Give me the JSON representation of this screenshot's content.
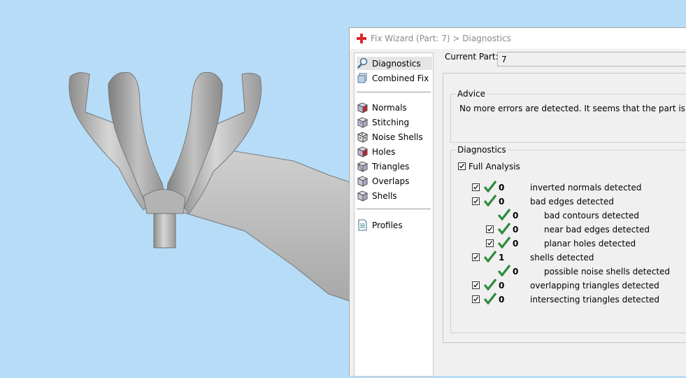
{
  "dialog": {
    "title": "Fix Wizard (Part: 7) > Diagnostics"
  },
  "nav": {
    "items": [
      {
        "label": "Diagnostics",
        "icon": "magnifier-icon"
      },
      {
        "label": "Combined Fix",
        "icon": "combined-fix-icon"
      },
      {
        "label": "Normals",
        "icon": "normals-cube-icon"
      },
      {
        "label": "Stitching",
        "icon": "stitching-cube-icon"
      },
      {
        "label": "Noise Shells",
        "icon": "noise-shells-dice-icon"
      },
      {
        "label": "Holes",
        "icon": "holes-cube-icon"
      },
      {
        "label": "Triangles",
        "icon": "triangles-cube-icon"
      },
      {
        "label": "Overlaps",
        "icon": "overlaps-cube-icon"
      },
      {
        "label": "Shells",
        "icon": "shells-cube-icon"
      },
      {
        "label": "Profiles",
        "icon": "profiles-document-icon"
      }
    ]
  },
  "current_part": {
    "label": "Current Part:",
    "value": "7"
  },
  "advice": {
    "title": "Advice",
    "text": "No more errors are detected. It seems that the part is ok."
  },
  "diagnostics": {
    "title": "Diagnostics",
    "full_analysis_label": "Full Analysis",
    "full_analysis_checked": true,
    "rows": [
      {
        "count": "0",
        "label": "inverted normals detected",
        "has_checkbox": true,
        "checked": true
      },
      {
        "count": "0",
        "label": "bad edges detected",
        "has_checkbox": true,
        "checked": true
      },
      {
        "count": "0",
        "label": "bad contours detected",
        "has_checkbox": false,
        "checked": false
      },
      {
        "count": "0",
        "label": "near bad edges detected",
        "has_checkbox": true,
        "checked": true
      },
      {
        "count": "0",
        "label": "planar holes detected",
        "has_checkbox": true,
        "checked": true
      },
      {
        "count": "1",
        "label": "shells detected",
        "has_checkbox": true,
        "checked": true
      },
      {
        "count": "0",
        "label": "possible noise shells detected",
        "has_checkbox": false,
        "checked": false
      },
      {
        "count": "0",
        "label": "overlapping triangles detected",
        "has_checkbox": true,
        "checked": true
      },
      {
        "count": "0",
        "label": "intersecting triangles detected",
        "has_checkbox": true,
        "checked": true
      }
    ]
  },
  "colors": {
    "viewport_background": "#b7dcf7",
    "check_green": "#2e8b3e",
    "app_icon_red": "#d62b2b"
  }
}
